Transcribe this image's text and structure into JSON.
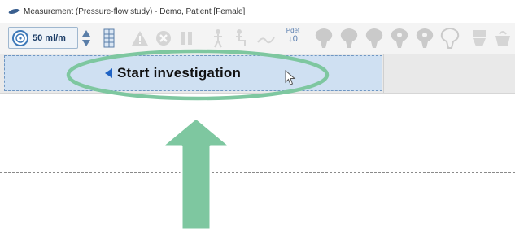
{
  "window": {
    "title": "Measurement (Pressure-flow study) - Demo, Patient [Female]"
  },
  "toolbar": {
    "flow_rate": "50 ml/m",
    "pdet_label": "Pdet",
    "pdet_sub": "↓0",
    "icons": [
      "flow-rate-icon",
      "spinner-arrows-icon",
      "column-grid-icon",
      "warning-icon",
      "stop-icon",
      "pause-icon",
      "standing-person-icon",
      "sitting-person-icon",
      "cough-icon",
      "pdet-zero-icon",
      "bladder-icon-1",
      "bladder-icon-2",
      "bladder-icon-3",
      "bladder-icon-4",
      "bladder-icon-5",
      "bladder-icon-6",
      "toilet-icon",
      "flow-cup-icon"
    ]
  },
  "main": {
    "start_label": "Start investigation"
  },
  "annotation": {
    "highlight_color": "#7ec7a0",
    "arrow_color": "#7ec7a0"
  }
}
